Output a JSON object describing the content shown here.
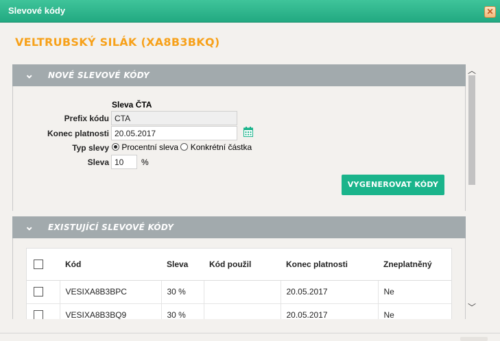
{
  "window": {
    "title": "Slevové kódy",
    "close_icon": "close-icon"
  },
  "heading": "VELTRUBSKÝ SILÁK (XA8B3BKQ)",
  "section_new": {
    "title": "NOVÉ SLEVOVÉ KÓDY",
    "subtitle": "Sleva ČTA",
    "prefix_label": "Prefix kódu",
    "prefix_value": "CTA",
    "end_label": "Konec platnosti",
    "end_value": "20.05.2017",
    "type_label": "Typ slevy",
    "type_options": [
      "Procentní sleva",
      "Konkrétní částka"
    ],
    "discount_label": "Sleva",
    "discount_value": "10",
    "discount_unit": "%",
    "generate_button": "VYGENEROVAT KÓDY"
  },
  "section_existing": {
    "title": "EXISTUJÍCÍ SLEVOVÉ KÓDY",
    "columns": [
      "Kód",
      "Sleva",
      "Kód použil",
      "Konec platnosti",
      "Zneplatněný"
    ],
    "rows": [
      {
        "code": "VESIXA8B3BPC",
        "discount": "30 %",
        "used_by": "",
        "end": "20.05.2017",
        "invalid": "Ne"
      },
      {
        "code": "VESIXA8B3BQ9",
        "discount": "30 %",
        "used_by": "",
        "end": "20.05.2017",
        "invalid": "Ne"
      }
    ]
  },
  "colors": {
    "accent": "#1ab48b",
    "heading": "#f7a11a",
    "section_bar": "#a2aaad"
  }
}
